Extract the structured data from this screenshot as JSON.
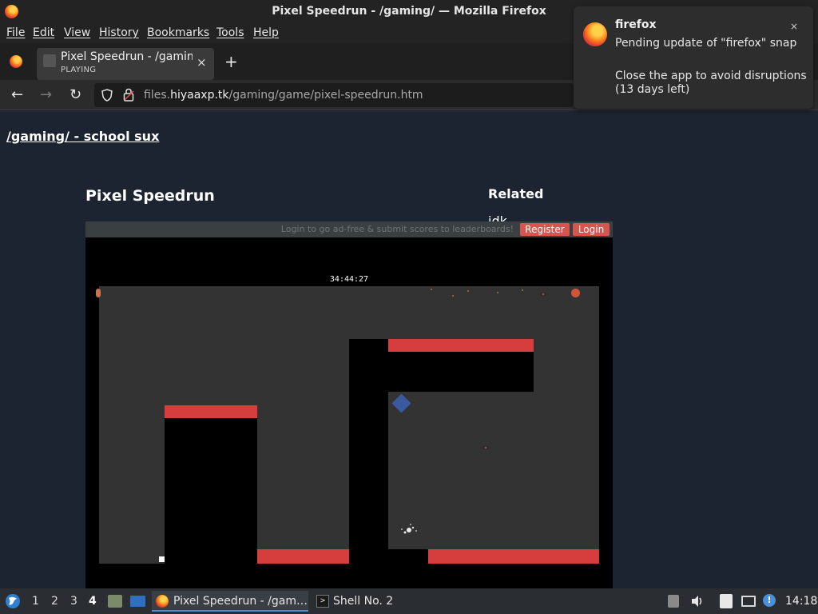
{
  "window": {
    "title": "Pixel Speedrun - /gaming/ — Mozilla Firefox"
  },
  "menubar": {
    "items": [
      "File",
      "Edit",
      "View",
      "History",
      "Bookmarks",
      "Tools",
      "Help"
    ]
  },
  "tab": {
    "title": "Pixel Speedrun - /gaming",
    "status": "PLAYING",
    "close_glyph": "×"
  },
  "newtab_glyph": "+",
  "nav": {
    "back_glyph": "←",
    "forward_glyph": "→",
    "reload_glyph": "↻",
    "url_prefix": "files.",
    "url_domain": "hiyaaxp.tk",
    "url_path": "/gaming/game/pixel-speedrun.htm"
  },
  "page": {
    "site_link": "/gaming/ - school sux",
    "game_title": "Pixel Speedrun",
    "related_title": "Related",
    "related_items": [
      "idk"
    ]
  },
  "game": {
    "login_message": "Login to go ad-free & submit scores to leaderboards!",
    "register_label": "Register",
    "login_label": "Login",
    "timer": "34:44:27",
    "colors": {
      "background": "#000000",
      "ground": "#333333",
      "platform": "#d63d3d",
      "player": "#3a5aa0"
    }
  },
  "notification": {
    "app": "firefox",
    "line1": "Pending update of \"firefox\" snap",
    "line2": "Close the app to avoid disruptions (13 days left)",
    "close_glyph": "×"
  },
  "taskbar": {
    "workspaces": [
      "1",
      "2",
      "3",
      "4"
    ],
    "active_workspace": "4",
    "tasks": [
      {
        "label": "Pixel Speedrun - /gam…",
        "icon": "firefox-icon"
      },
      {
        "label": "Shell No. 2",
        "icon": "terminal-icon"
      }
    ],
    "clock": "14:18"
  }
}
